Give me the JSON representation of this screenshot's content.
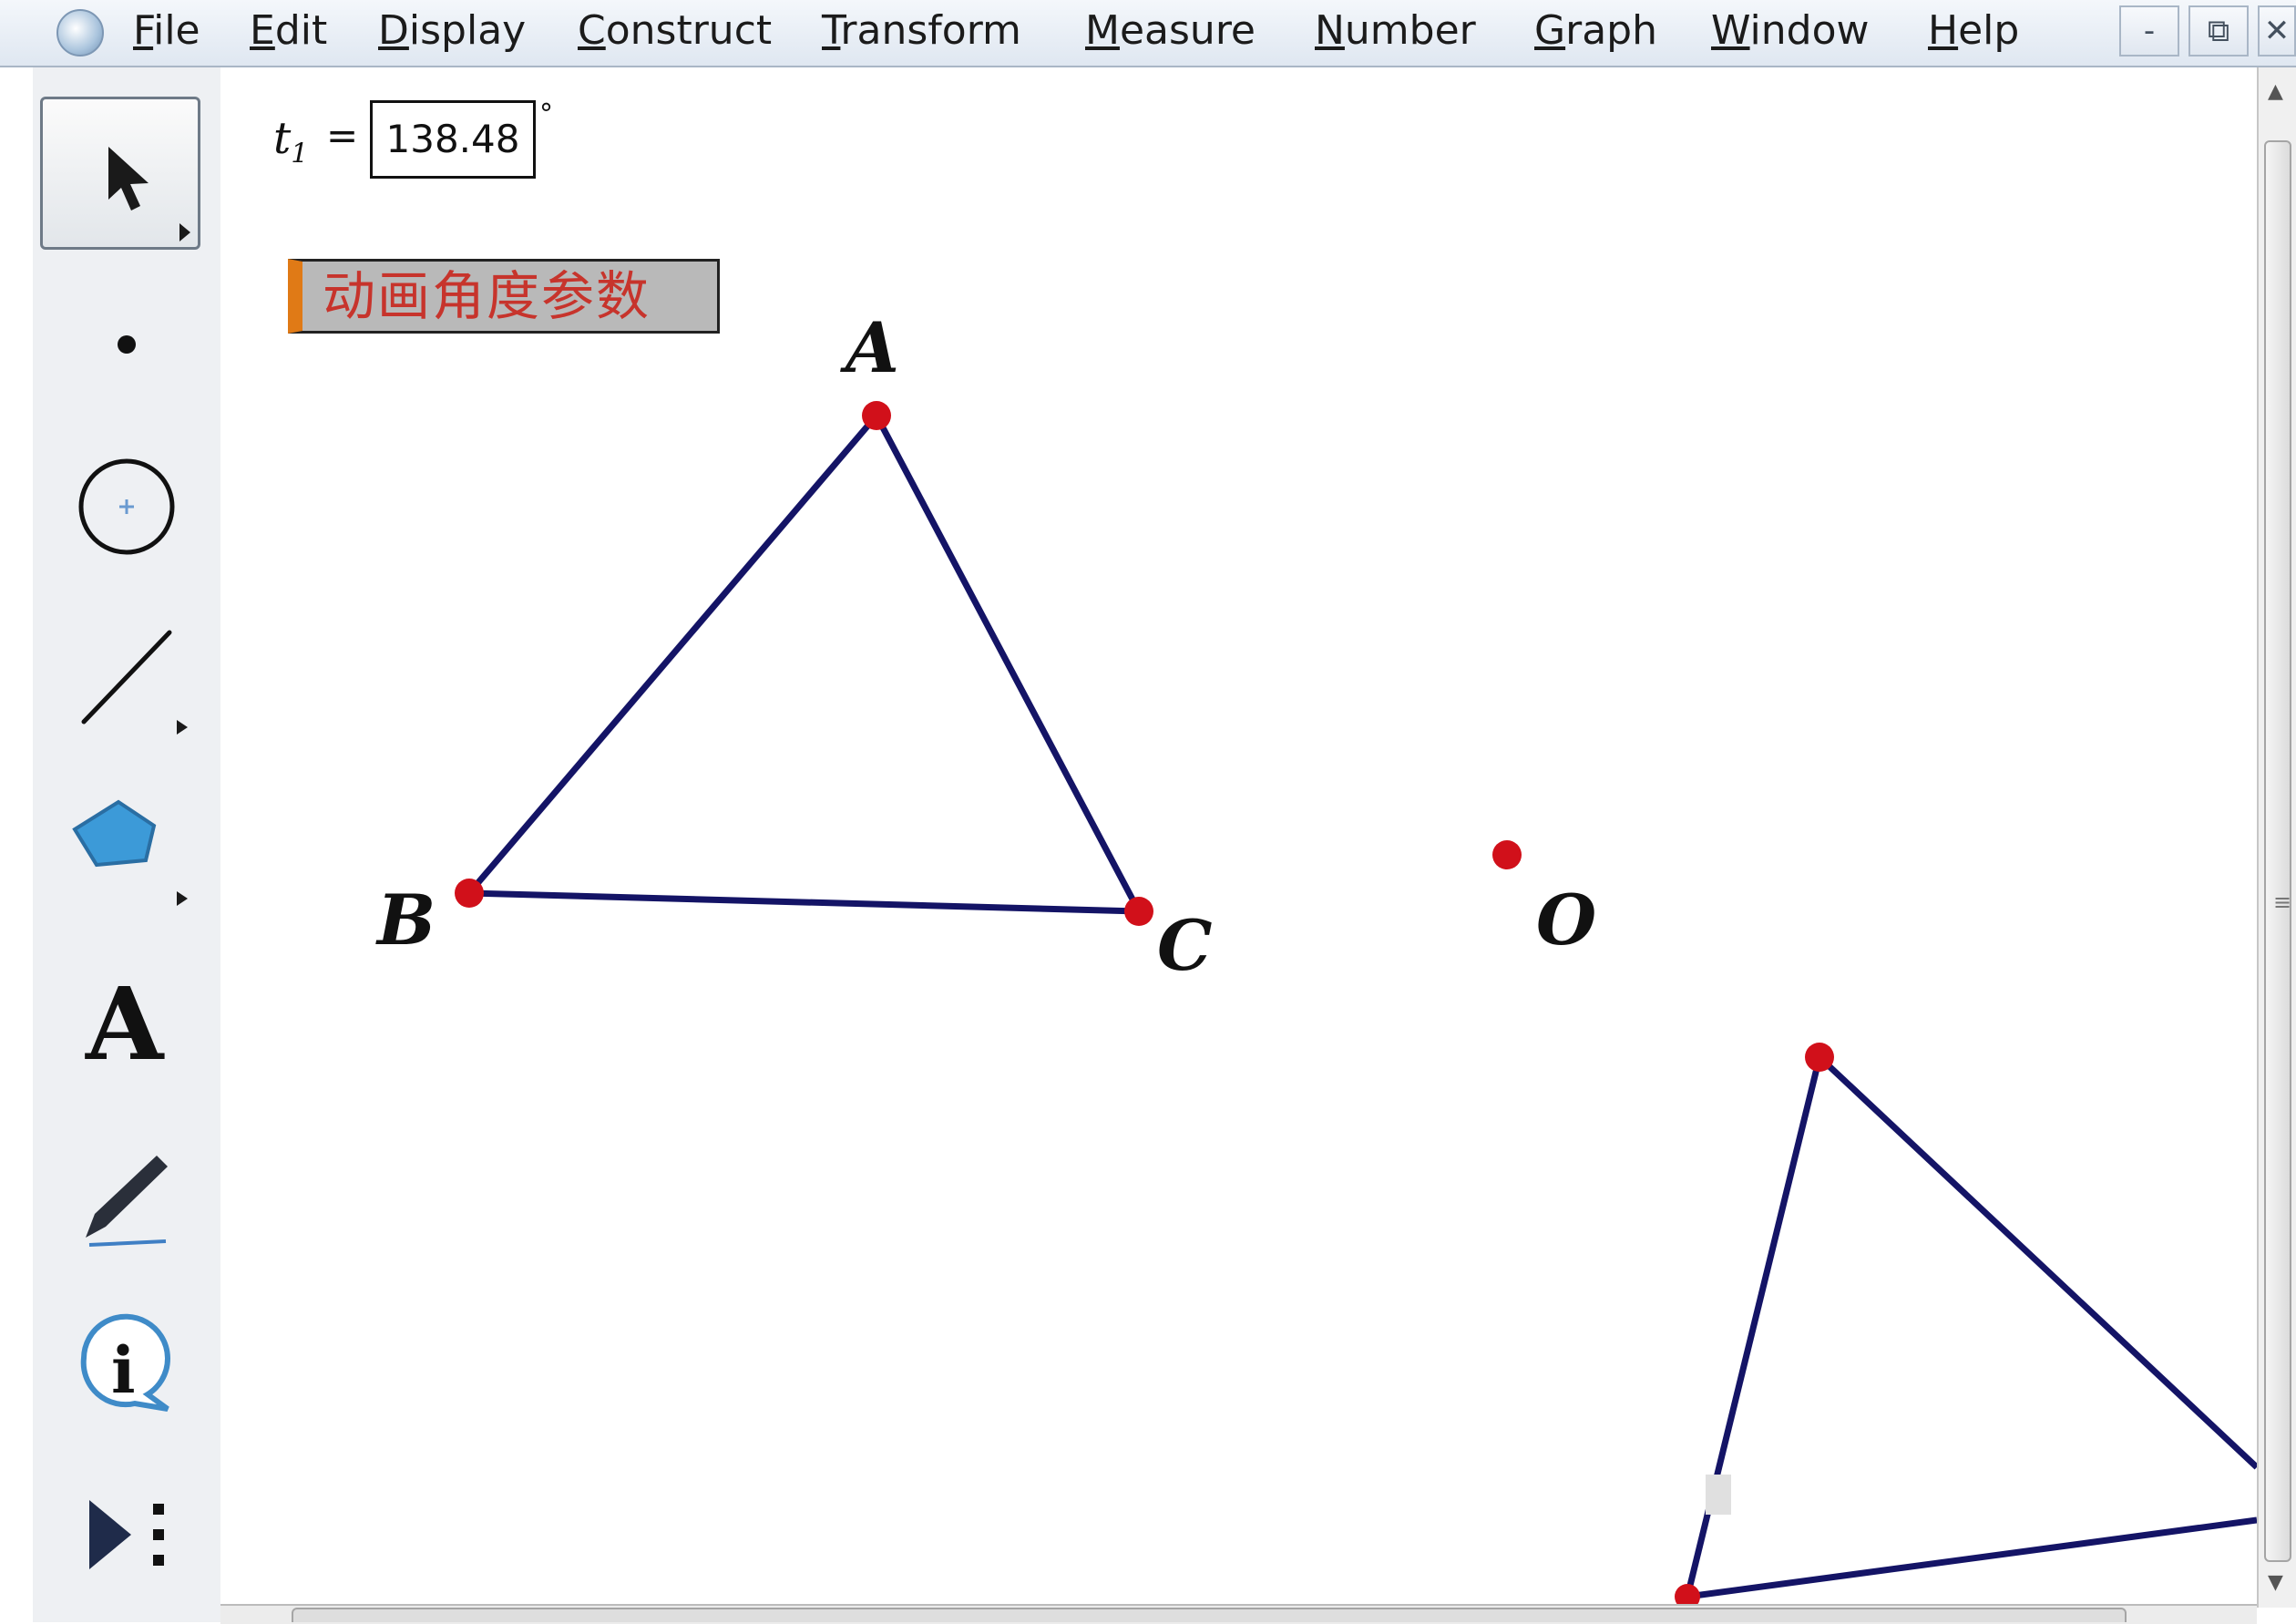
{
  "menu": {
    "items": [
      "File",
      "Edit",
      "Display",
      "Construct",
      "Transform",
      "Measure",
      "Number",
      "Graph",
      "Window",
      "Help"
    ]
  },
  "window_controls": {
    "minimize": "-",
    "restore": "⧉",
    "close": "✕"
  },
  "toolbox": {
    "tools": [
      {
        "name": "arrow-tool-icon",
        "selected": true
      },
      {
        "name": "point-tool-icon"
      },
      {
        "name": "compass-tool-icon"
      },
      {
        "name": "straightedge-tool-icon"
      },
      {
        "name": "polygon-tool-icon"
      },
      {
        "name": "text-tool-icon",
        "glyph": "A"
      },
      {
        "name": "marker-tool-icon"
      },
      {
        "name": "information-tool-icon",
        "glyph": "i"
      },
      {
        "name": "custom-tool-icon"
      }
    ]
  },
  "parameter": {
    "name": "t",
    "subscript": "1",
    "equals": "=",
    "value": "138.48",
    "unit": "°"
  },
  "animate_button": {
    "label": "动画角度参数"
  },
  "geometry": {
    "labels": {
      "A": "A",
      "B": "B",
      "C": "C",
      "O": "O"
    },
    "colors": {
      "segment": "#141466",
      "point": "#d1101a",
      "label": "#111111"
    }
  },
  "colors": {
    "menubar": "#e6ecf3",
    "toolbox": "#eef0f3",
    "button_accent": "#e07a16",
    "button_text": "#c7342c"
  }
}
